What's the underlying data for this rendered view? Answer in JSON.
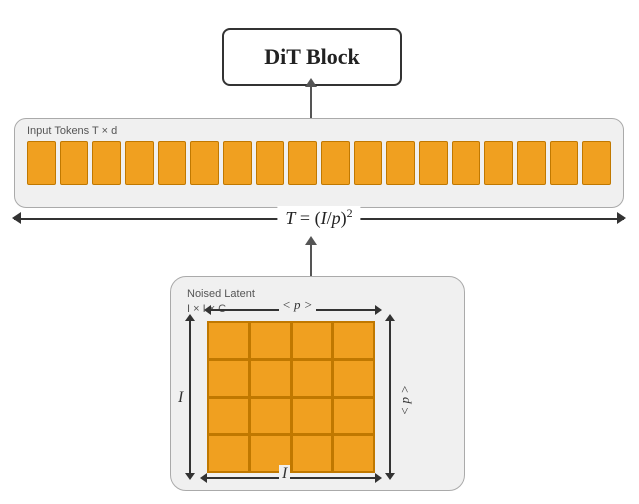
{
  "dit_block": {
    "label": "DiT Block"
  },
  "input_tokens": {
    "label": "Input Tokens T × d",
    "formula": "T = (I/p)",
    "formula_sup": "2",
    "token_count": 18
  },
  "noised_latent": {
    "label": "Noised Latent",
    "sublabel": "I × I × C",
    "p_top_label": "< p >",
    "p_right_label": "< p >",
    "i_left_label": "I",
    "i_bottom_label": "I",
    "grid_cols": 4,
    "grid_rows": 4
  },
  "colors": {
    "orange": "#f0a020",
    "orange_border": "#c07800",
    "container_bg": "#f0f0f0",
    "container_border": "#aaa",
    "arrow": "#555",
    "text": "#222"
  }
}
